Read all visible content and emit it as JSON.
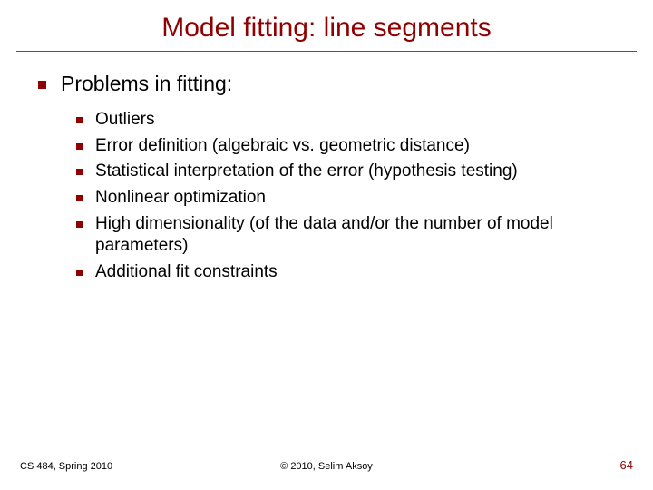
{
  "title": "Model fitting: line segments",
  "heading": "Problems in fitting:",
  "items": [
    "Outliers",
    "Error definition (algebraic vs. geometric distance)",
    "Statistical interpretation of the error (hypothesis testing)",
    "Nonlinear optimization",
    "High dimensionality (of the data and/or the number of model parameters)",
    "Additional fit constraints"
  ],
  "footer": {
    "left": "CS 484, Spring 2010",
    "center": "© 2010, Selim Aksoy",
    "right": "64"
  }
}
